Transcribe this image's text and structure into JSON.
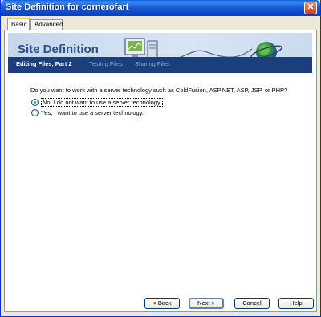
{
  "window": {
    "title": "Site Definition for cornerofart",
    "close_glyph": "✕"
  },
  "tabs": [
    {
      "label": "Basic",
      "selected": true
    },
    {
      "label": "Advanced",
      "selected": false
    }
  ],
  "banner": {
    "title": "Site Definition",
    "icons": [
      "computer-icon",
      "globe-icon"
    ]
  },
  "steps": [
    {
      "label": "Editing Files, Part 2",
      "active": true
    },
    {
      "label": "Testing Files",
      "active": false
    },
    {
      "label": "Sharing Files",
      "active": false
    }
  ],
  "question": "Do you want to work with a server technology such as ColdFusion, ASP.NET, ASP, JSP, or PHP?",
  "options": [
    {
      "label": "No, I do not want to use a server technology.",
      "selected": true
    },
    {
      "label": "Yes, I want to use a server technology.",
      "selected": false
    }
  ],
  "buttons": {
    "back": "< Back",
    "next": "Next >",
    "cancel": "Cancel",
    "help": "Help"
  },
  "colors": {
    "titlebar": "#0c47c9",
    "steps_bar": "#1b3f7c",
    "banner_title": "#2b4e86",
    "radio_dot": "#21a121"
  }
}
